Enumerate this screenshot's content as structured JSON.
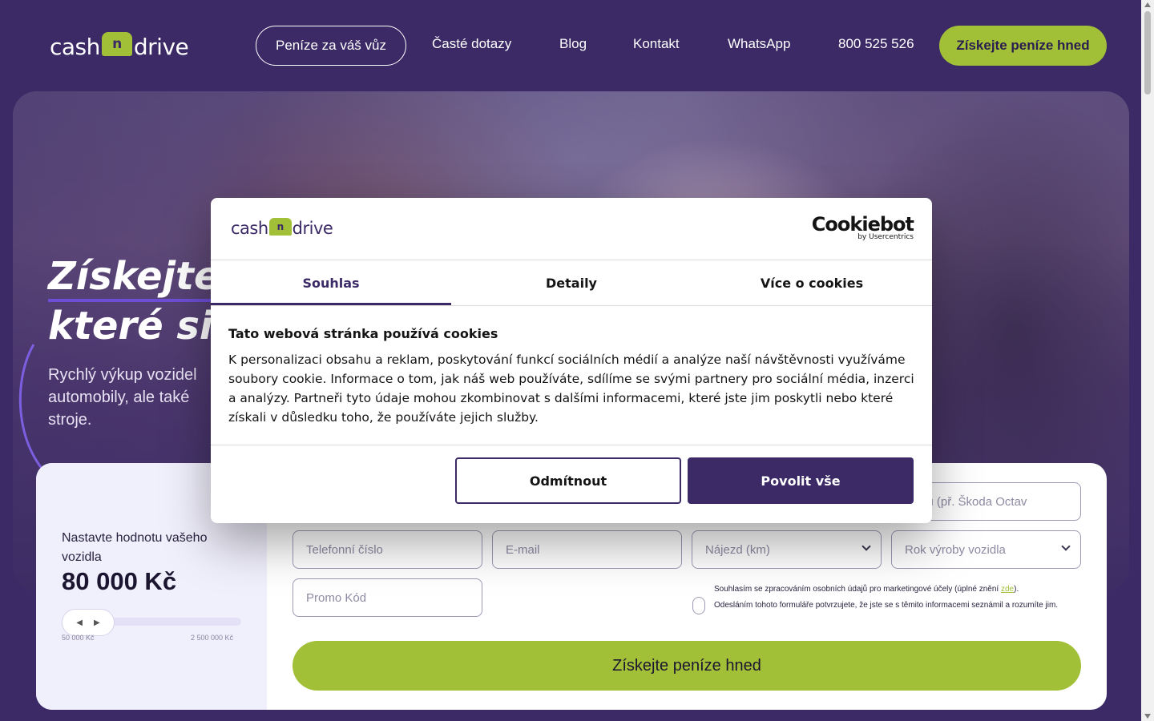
{
  "colors": {
    "brand_purple": "#3b2a66",
    "brand_green": "#a2c037",
    "white": "#ffffff"
  },
  "header": {
    "logo_left": "cash",
    "logo_mark": "n",
    "logo_right": "drive",
    "nav_outline": "Peníze za váš vůz",
    "nav_links": [
      "Časté dotazy",
      "Blog",
      "Kontakt",
      "WhatsApp",
      "800 525 526"
    ],
    "cta": "Získejte peníze hned"
  },
  "hero": {
    "title_line1": "Získejte",
    "title_line2": "které si",
    "subtitle_lines": [
      "Rychlý výkup vozidel",
      "automobily, ale také",
      "stroje."
    ]
  },
  "form": {
    "value_label": "Nastavte hodnotu vašeho vozidla",
    "value": "80 000 Kč",
    "slider_level": 0.02,
    "slider_min": "50 000 Kč",
    "slider_max": "2 500 000 Kč",
    "model_placeholder": "ka vozu (př. Škoda Octav",
    "phone_placeholder": "Telefonní číslo",
    "email_placeholder": "E-mail",
    "mileage_placeholder": "Nájezd (km)",
    "year_placeholder": "Rok výroby vozidla",
    "promo_placeholder": "Promo Kód",
    "consent_line1": "Souhlasím se zpracováním osobních údajů pro marketingové účely (úplné znění ",
    "consent_link": "zde",
    "consent_line1_end": ").",
    "consent_line2": "Odesláním tohoto formuláře potvrzujete, že jste se s těmito informacemi seznámil a rozumíte jim.",
    "submit": "Získejte peníze hned"
  },
  "modal": {
    "logo_left": "cash",
    "logo_mark": "n",
    "logo_right": "drive",
    "cookiebot": "Cookiebot",
    "cookiebot_sub": "by Usercentrics",
    "tabs": [
      "Souhlas",
      "Detaily",
      "Více o cookies"
    ],
    "heading": "Tato webová stránka používá cookies",
    "body": "K personalizaci obsahu a reklam, poskytování funkcí sociálních médií a analýze naší návštěvnosti využíváme soubory cookie. Informace o tom, jak náš web používáte, sdílíme se svými partnery pro sociální média, inzerci a analýzy. Partneři tyto údaje mohou zkombinovat s dalšími informacemi, které jste jim poskytli nebo které získali v důsledku toho, že používáte jejich služby.",
    "deny": "Odmítnout",
    "allow": "Povolit vše"
  }
}
